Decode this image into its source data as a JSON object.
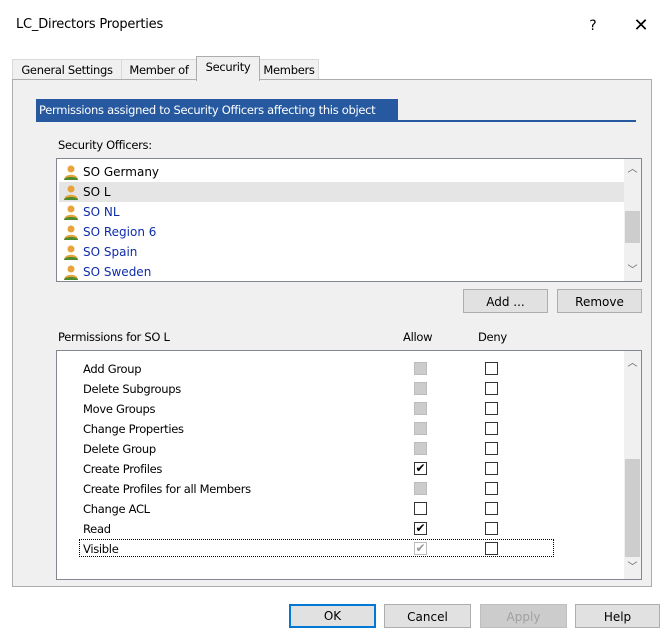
{
  "window": {
    "title": "LC_Directors Properties",
    "help": "?",
    "close": "✕"
  },
  "tabs": [
    {
      "label": "General Settings"
    },
    {
      "label": "Member of"
    },
    {
      "label": "Security"
    },
    {
      "label": "Members"
    }
  ],
  "banner": "Permissions assigned to Security Officers affecting this object",
  "officers": {
    "label": "Security Officers:",
    "items": [
      {
        "label": "SO Germany",
        "selected": false,
        "blue": false
      },
      {
        "label": "SO L",
        "selected": true,
        "blue": false
      },
      {
        "label": "SO NL",
        "selected": false,
        "blue": true
      },
      {
        "label": "SO Region 6",
        "selected": false,
        "blue": true
      },
      {
        "label": "SO Spain",
        "selected": false,
        "blue": true
      },
      {
        "label": "SO Sweden",
        "selected": false,
        "blue": true
      }
    ]
  },
  "buttons": {
    "add": "Add ...",
    "remove": "Remove",
    "ok": "OK",
    "cancel": "Cancel",
    "apply": "Apply",
    "help": "Help"
  },
  "permissions": {
    "label": "Permissions for SO L",
    "allow_header": "Allow",
    "deny_header": "Deny",
    "items": [
      {
        "name": "Add Group",
        "allow": "gray",
        "deny": "unchecked"
      },
      {
        "name": "Delete Subgroups",
        "allow": "gray",
        "deny": "unchecked"
      },
      {
        "name": "Move Groups",
        "allow": "gray",
        "deny": "unchecked"
      },
      {
        "name": "Change Properties",
        "allow": "gray",
        "deny": "unchecked"
      },
      {
        "name": "Delete Group",
        "allow": "gray",
        "deny": "unchecked"
      },
      {
        "name": "Create Profiles",
        "allow": "checked",
        "deny": "unchecked"
      },
      {
        "name": "Create Profiles for all Members",
        "allow": "gray",
        "deny": "unchecked"
      },
      {
        "name": "Change ACL",
        "allow": "unchecked",
        "deny": "unchecked"
      },
      {
        "name": "Read",
        "allow": "checked",
        "deny": "unchecked"
      },
      {
        "name": "Visible",
        "allow": "gray-checked",
        "deny": "unchecked"
      }
    ]
  },
  "colors": {
    "accent": "#26599f",
    "focus": "#0078d7",
    "link": "#0f2daa"
  }
}
